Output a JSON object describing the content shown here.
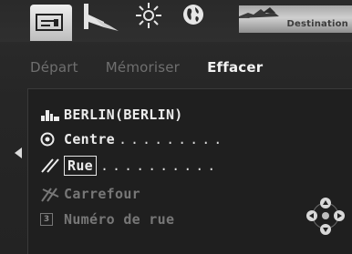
{
  "header": {
    "tabs": [
      {
        "icon": "address-card-icon"
      },
      {
        "icon": "road-icon"
      },
      {
        "icon": "sun-icon"
      },
      {
        "icon": "globe-icon"
      }
    ],
    "destination_label": "Destination"
  },
  "menu": {
    "items": [
      {
        "label": "Départ",
        "active": false
      },
      {
        "label": "Mémoriser",
        "active": false
      },
      {
        "label": "Effacer",
        "active": true
      }
    ]
  },
  "address": {
    "city": {
      "icon": "city-skyline-icon",
      "label": "BERLIN(BERLIN)"
    },
    "centre": {
      "icon": "target-icon",
      "label": "Centre",
      "dots": "........."
    },
    "street": {
      "icon": "road-lines-icon",
      "label": "Rue",
      "dots": ".........."
    },
    "crossing": {
      "icon": "crossroad-icon",
      "label": "Carrefour"
    },
    "house_number": {
      "icon": "number-box-icon",
      "icon_text": "3",
      "label": "Numéro de rue"
    }
  },
  "colors": {
    "background": "#232323",
    "text_active": "#f2f2f2",
    "text_dim": "#777777"
  }
}
